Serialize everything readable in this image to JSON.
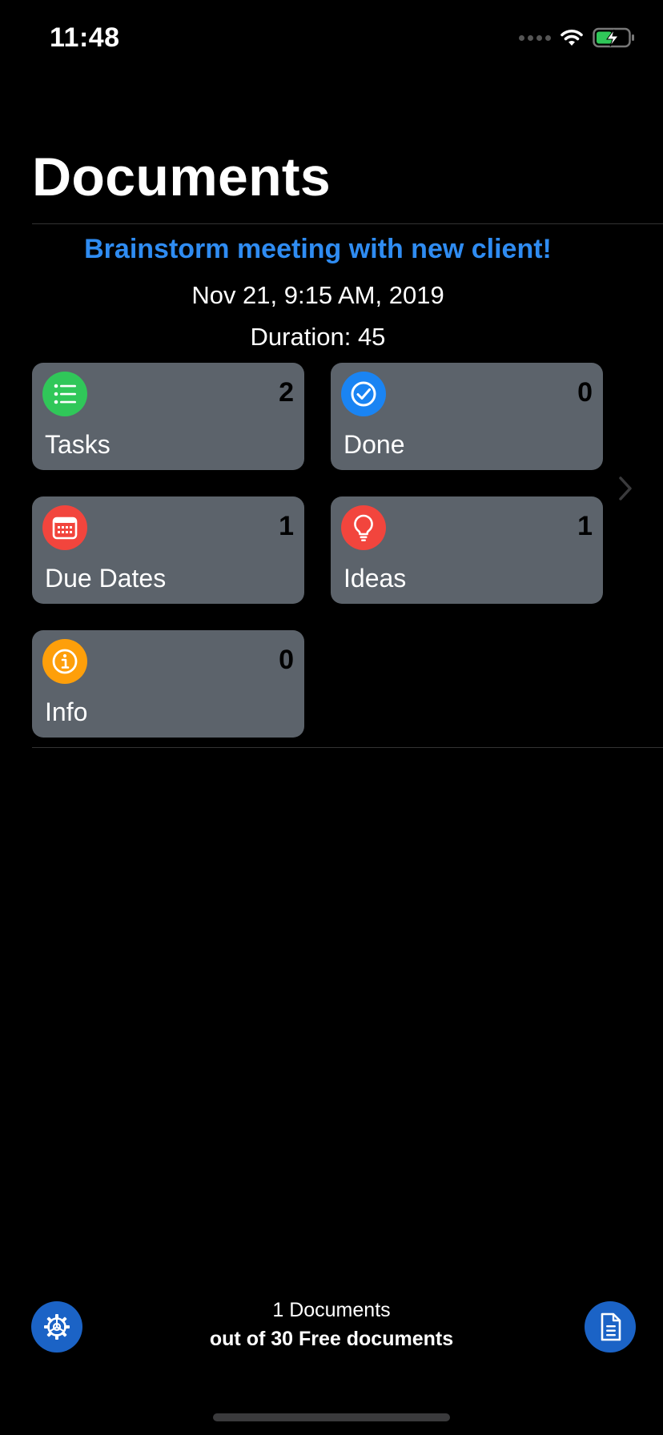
{
  "status_bar": {
    "time": "11:48"
  },
  "header": {
    "title": "Documents"
  },
  "document": {
    "title": "Brainstorm meeting with new client!",
    "date": "Nov 21, 9:15 AM, 2019",
    "duration": "Duration: 45"
  },
  "categories": [
    {
      "label": "Tasks",
      "count": "2",
      "icon": "list-icon",
      "color": "#30c759"
    },
    {
      "label": "Done",
      "count": "0",
      "icon": "checkmark-circle-icon",
      "color": "#1a84f3"
    },
    {
      "label": "Due Dates",
      "count": "1",
      "icon": "calendar-icon",
      "color": "#f2453d"
    },
    {
      "label": "Ideas",
      "count": "1",
      "icon": "lightbulb-icon",
      "color": "#f2453d"
    },
    {
      "label": "Info",
      "count": "0",
      "icon": "info-icon",
      "color": "#fe9f0a"
    }
  ],
  "footer": {
    "count_text": "1 Documents",
    "limit_text": "out of 30 Free documents",
    "settings_icon": "gear-icon",
    "new_document_icon": "document-icon"
  },
  "colors": {
    "accent": "#2f8cf2",
    "card_background": "#5c636b",
    "button_blue": "#1b63c6"
  }
}
